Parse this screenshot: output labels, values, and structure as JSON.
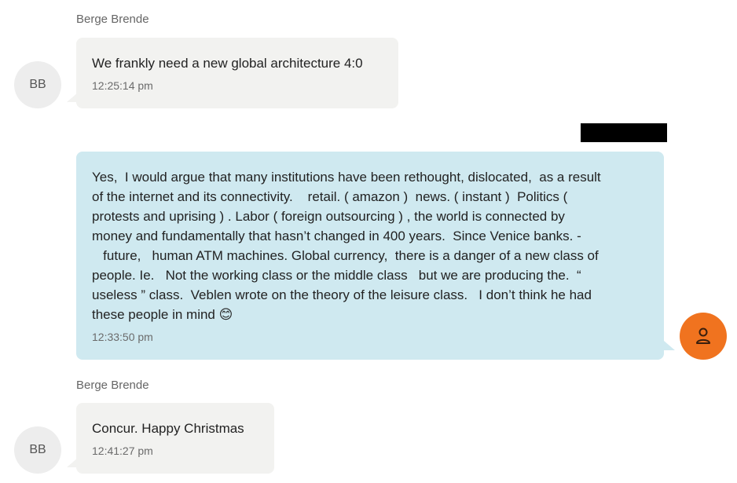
{
  "messages": [
    {
      "sender": "Berge Brende",
      "avatar": "BB",
      "text": "We frankly need a new global architecture 4:0",
      "time": "12:25:14 pm"
    },
    {
      "text": "Yes,  I would argue that many institutions have been rethought, dislocated,  as a result\nof the internet and its connectivity.    retail. ( amazon )  news. ( instant )  Politics (\nprotests and uprising ) . Labor ( foreign outsourcing ) , the world is connected by\nmoney and fundamentally that hasn’t changed in 400 years.  Since Venice banks. -\n   future,   human ATM machines. Global currency,  there is a danger of a new class of\npeople. Ie.   Not the working class or the middle class   but we are producing the.  “\nuseless ” class.  Veblen wrote on the theory of the leisure class.   I don’t think he had\nthese people in mind 😊",
      "time": "12:33:50 pm",
      "avatar_icon": "person-icon"
    },
    {
      "sender": "Berge Brende",
      "avatar": "BB",
      "text": "Concur. Happy Christmas",
      "time": "12:41:27 pm"
    }
  ],
  "colors": {
    "incoming_bubble": "#f2f2f0",
    "outgoing_bubble": "#cfe9f0",
    "user_avatar": "#f0731f"
  }
}
